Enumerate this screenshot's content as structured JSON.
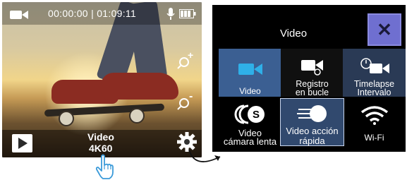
{
  "preview": {
    "timecode": "00:00:00 | 01:09:11",
    "mode_line1": "Video",
    "mode_line2": "4K60",
    "zoom_in": "+",
    "zoom_out": "-",
    "icons": [
      "video-camera-icon",
      "microphone-icon",
      "battery-icon",
      "zoom-in-icon",
      "zoom-out-icon",
      "play-icon",
      "gear-icon",
      "hand-pointer-icon"
    ]
  },
  "menu": {
    "title": "Video",
    "close_label": "✕",
    "items": [
      {
        "label_lines": [
          "Video"
        ],
        "icon": "video-camera-icon",
        "state": "selected"
      },
      {
        "label_lines": [
          "Registro",
          "en bucle"
        ],
        "icon": "loop-record-icon",
        "state": "normal"
      },
      {
        "label_lines": [
          "Timelapse",
          "Intervalo"
        ],
        "icon": "timelapse-icon",
        "state": "normal"
      },
      {
        "label_lines": [
          "Video",
          "cámara lenta"
        ],
        "icon": "slow-motion-icon",
        "state": "normal"
      },
      {
        "label_lines": [
          "Video acción",
          "rápida"
        ],
        "icon": "fast-motion-icon",
        "state": "highlighted"
      },
      {
        "label_lines": [
          "Wi-Fi"
        ],
        "icon": "wifi-icon",
        "state": "normal"
      }
    ]
  },
  "colors": {
    "accent": "#3b5f92",
    "close": "#6f6fd0",
    "hand": "#3a9ad9"
  }
}
